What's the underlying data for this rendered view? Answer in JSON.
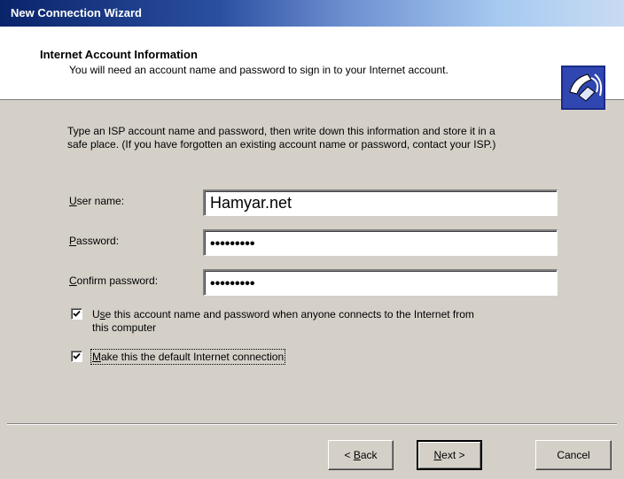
{
  "window": {
    "title": "New Connection Wizard"
  },
  "header": {
    "title": "Internet Account Information",
    "subtitle": "You will need an account name and password to sign in to your Internet account."
  },
  "intro": {
    "line1": "Type an ISP account name and password, then write down this information and store it in a",
    "line2": "safe place. (If you have forgotten an existing account name or password, contact your ISP.)"
  },
  "form": {
    "username": {
      "label_pre": "",
      "label_key": "U",
      "label_post": "ser name:",
      "value": "Hamyar.net"
    },
    "password": {
      "label_pre": "",
      "label_key": "P",
      "label_post": "assword:",
      "value": "•••••••••"
    },
    "confirm": {
      "label_pre": "",
      "label_key": "C",
      "label_post": "onfirm password:",
      "value": "•••••••••"
    }
  },
  "options": {
    "use_account": {
      "checked": true,
      "label_pre": "U",
      "label_key": "s",
      "label_post": "e this account  name and password when anyone connects to the Internet from",
      "label_line2": "this computer"
    },
    "default_conn": {
      "checked": true,
      "label_pre": "",
      "label_key": "M",
      "label_post": "ake this the default Internet connection"
    }
  },
  "buttons": {
    "back": {
      "pre": "< ",
      "key": "B",
      "post": "ack"
    },
    "next": {
      "pre": "",
      "key": "N",
      "post": "ext >"
    },
    "cancel": "Cancel"
  },
  "icons": {
    "header_logo": "phone-connection-icon",
    "checkmark": "checkmark-icon"
  }
}
